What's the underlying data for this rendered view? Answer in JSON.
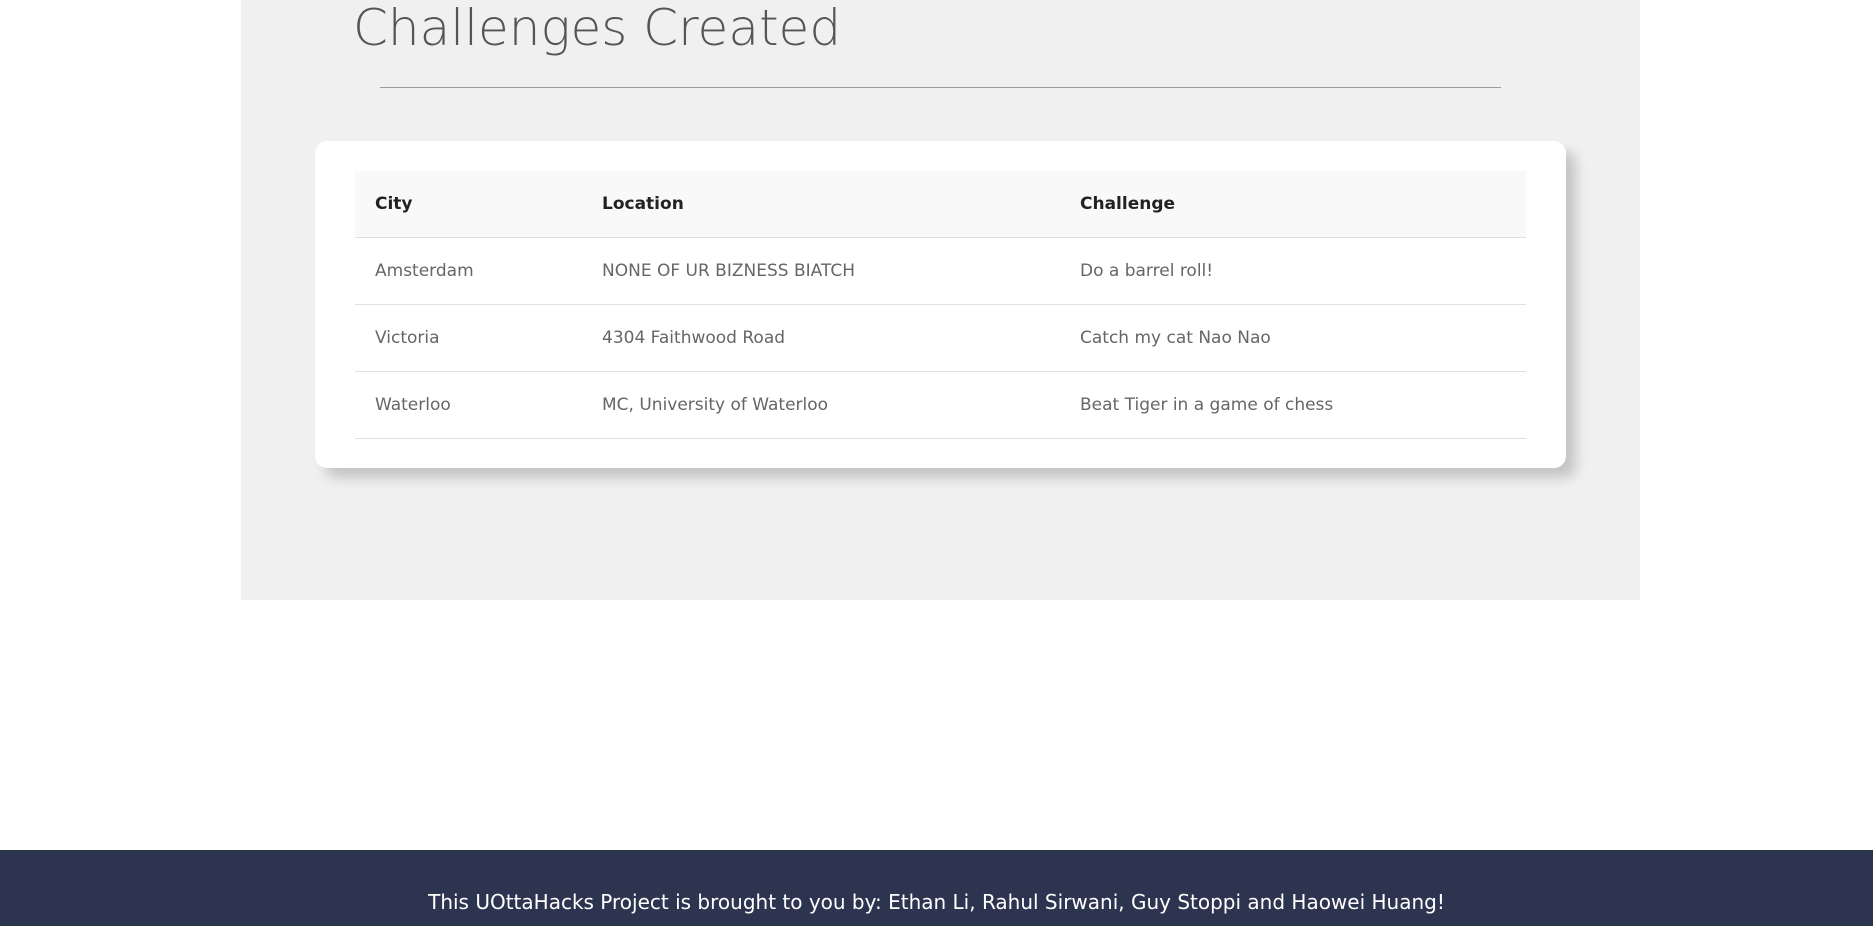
{
  "page": {
    "title": "Challenges Created"
  },
  "table": {
    "headers": {
      "city": "City",
      "location": "Location",
      "challenge": "Challenge"
    },
    "rows": [
      {
        "city": "Amsterdam",
        "location": "NONE OF UR BIZNESS BIATCH",
        "challenge": "Do a barrel roll!"
      },
      {
        "city": "Victoria",
        "location": "4304 Faithwood Road",
        "challenge": "Catch my cat Nao Nao"
      },
      {
        "city": "Waterloo",
        "location": "MC, University of Waterloo",
        "challenge": "Beat Tiger in a game of chess"
      }
    ]
  },
  "footer": {
    "credits": "This UOttaHacks Project is brought to you by: Ethan Li, Rahul Sirwani, Guy Stoppi and Haowei Huang!"
  },
  "colors": {
    "section_background": "#f0f0f0",
    "footer_background": "#2d3450",
    "title_text": "#555555"
  }
}
